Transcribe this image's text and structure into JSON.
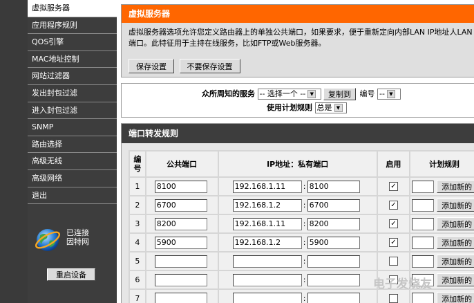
{
  "sidebar": {
    "items": [
      {
        "label": "虚拟服务器",
        "active": true
      },
      {
        "label": "应用程序规则",
        "active": false
      },
      {
        "label": "QOS引擎",
        "active": false
      },
      {
        "label": "MAC地址控制",
        "active": false
      },
      {
        "label": "网站过滤器",
        "active": false
      },
      {
        "label": "发出封包过滤",
        "active": false
      },
      {
        "label": "进入封包过滤",
        "active": false
      },
      {
        "label": "SNMP",
        "active": false
      },
      {
        "label": "路由选择",
        "active": false
      },
      {
        "label": "高级无线",
        "active": false
      },
      {
        "label": "高级网络",
        "active": false
      },
      {
        "label": "退出",
        "active": false
      }
    ],
    "status_line1": "已连接",
    "status_line2": "因特网",
    "reboot_label": "重启设备"
  },
  "virtual_server": {
    "title": "虚拟服务器",
    "description": "虚拟服务器选项允许您定义路由器上的单独公共端口，如果要求，便于重新定向内部LAN IP地址人LAN端口。此特征用于主持在线服务，比如FTP或Web服务器。",
    "save_label": "保存设置",
    "dont_save_label": "不要保存设置"
  },
  "known_services": {
    "label": "众所周知的服务",
    "service_select": "-- 选择一个 --",
    "copy_label": "复制到",
    "number_label": "编号",
    "number_select": "--",
    "schedule_label": "使用计划规则",
    "schedule_select": "总是"
  },
  "rules": {
    "title": "端口转发规则",
    "headers": {
      "num": "编号",
      "public_port": "公共端口",
      "ip_private": "IP地址：私有端口",
      "enable": "启用",
      "schedule": "计划规则"
    },
    "add_label": "添加新的",
    "separator": ":",
    "rows": [
      {
        "num": "1",
        "public": "8100",
        "ip": "192.168.1.11",
        "private": "8100",
        "enabled": "✓",
        "schedule": ""
      },
      {
        "num": "2",
        "public": "6700",
        "ip": "192.168.1.2",
        "private": "6700",
        "enabled": "✓",
        "schedule": ""
      },
      {
        "num": "3",
        "public": "8200",
        "ip": "192.168.1.11",
        "private": "8200",
        "enabled": "✓",
        "schedule": ""
      },
      {
        "num": "4",
        "public": "5900",
        "ip": "192.168.1.2",
        "private": "5900",
        "enabled": "✓",
        "schedule": ""
      },
      {
        "num": "5",
        "public": "",
        "ip": "",
        "private": "",
        "enabled": "",
        "schedule": ""
      },
      {
        "num": "6",
        "public": "",
        "ip": "",
        "private": "",
        "enabled": "",
        "schedule": ""
      },
      {
        "num": "7",
        "public": "",
        "ip": "",
        "private": "",
        "enabled": "",
        "schedule": ""
      }
    ]
  },
  "watermark": "电子发烧友",
  "colors": {
    "accent": "#ff6600",
    "sidebar": "#3d3d3d"
  }
}
